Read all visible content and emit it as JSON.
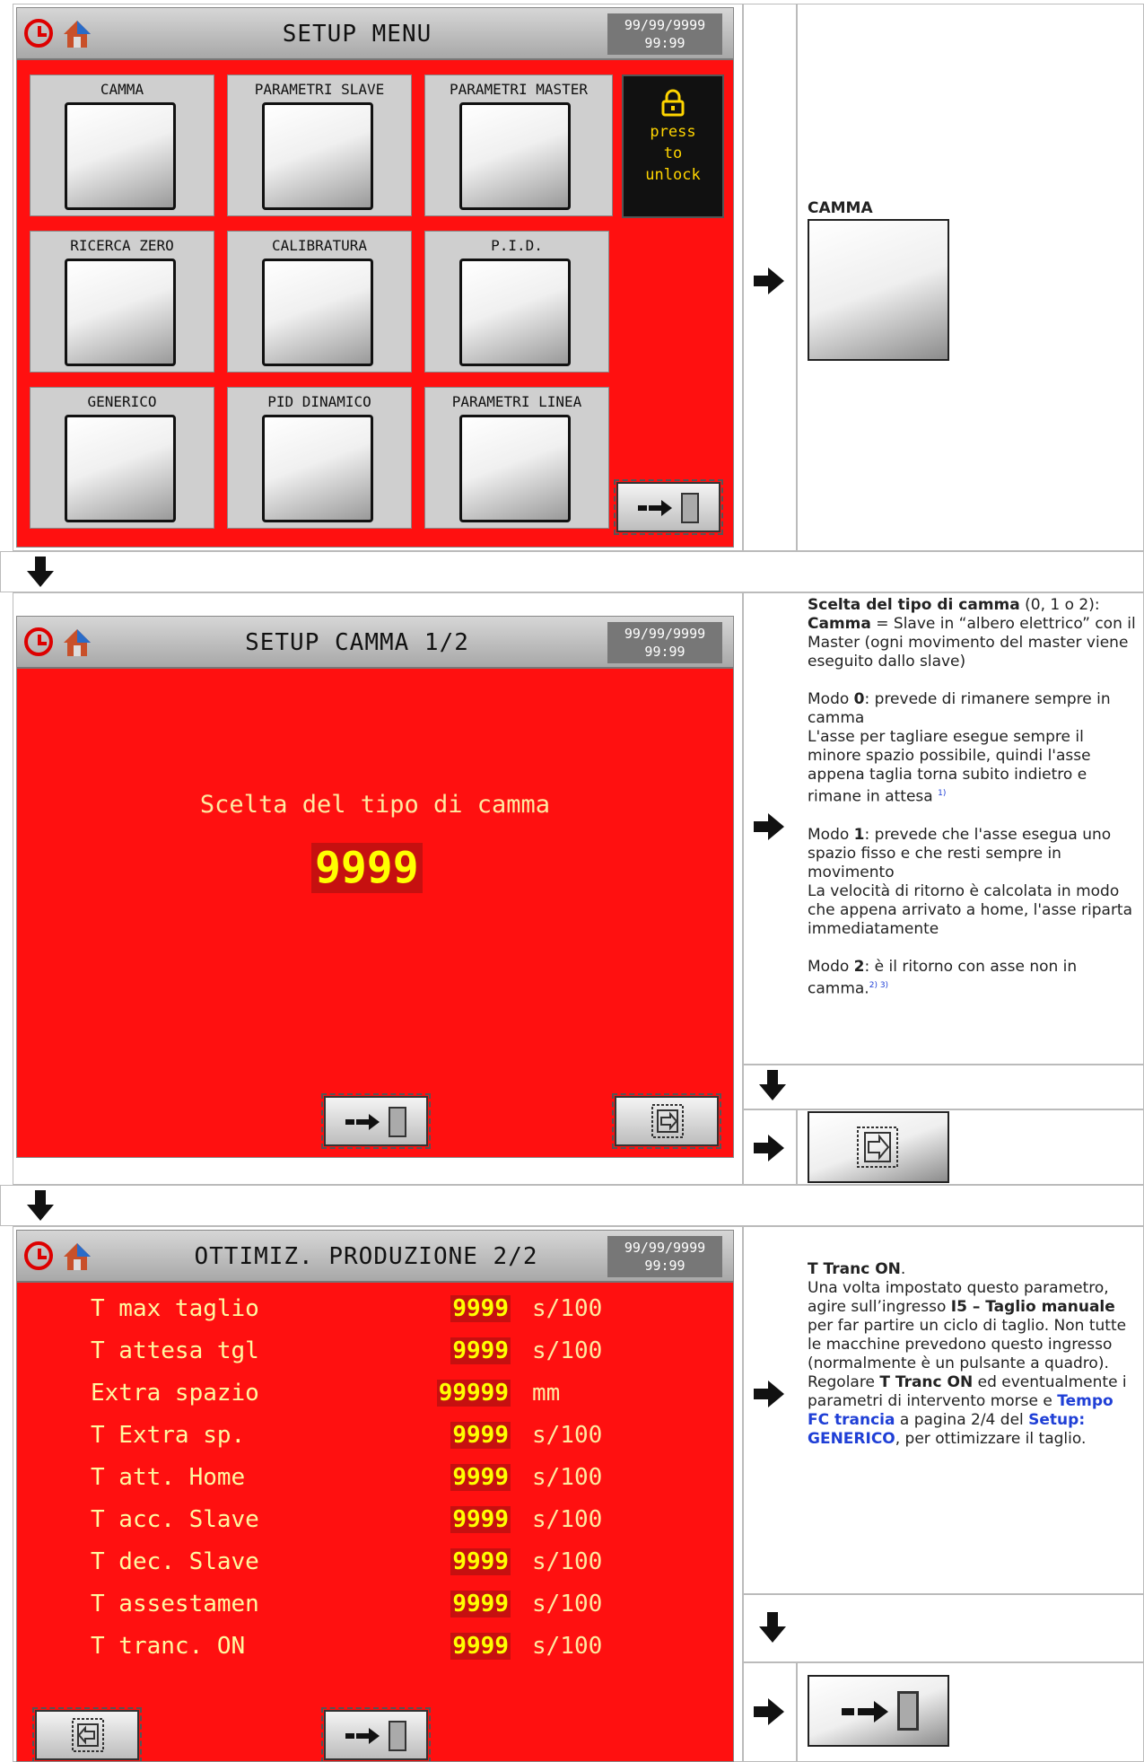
{
  "screen1": {
    "title": "SETUP MENU",
    "date": "99/99/9999",
    "time": "99:99",
    "tiles": [
      {
        "label": "CAMMA"
      },
      {
        "label": "PARAMETRI SLAVE"
      },
      {
        "label": "PARAMETRI MASTER"
      },
      {
        "label": "RICERCA ZERO"
      },
      {
        "label": "CALIBRATURA"
      },
      {
        "label": "P.I.D."
      },
      {
        "label": "GENERICO"
      },
      {
        "label": "PID DINAMICO"
      },
      {
        "label": "PARAMETRI LINEA"
      }
    ],
    "lock": {
      "line1": "press",
      "line2": "to",
      "line3": "unlock"
    }
  },
  "side1": {
    "heading": "CAMMA"
  },
  "screen2": {
    "title": "SETUP CAMMA 1/2",
    "date": "99/99/9999",
    "time": "99:99",
    "label": "Scelta del tipo di camma",
    "value": "9999"
  },
  "side2": {
    "p1_b": "Scelta del tipo di camma",
    "p1_t": " (0, 1 o 2):",
    "p2_b": "Camma",
    "p2_t": " = Slave in “albero elettrico” con il Master (ogni movimento del master viene eseguito dallo slave)",
    "p3_a": "Modo ",
    "p3_b": "0",
    "p3_t": ": prevede di rimanere sempre in camma",
    "p4": "L'asse per tagliare esegue sempre il minore spazio possibile, quindi l'asse appena taglia torna subito indietro e rimane in attesa",
    "p4_note": "1)",
    "p5_a": "Modo ",
    "p5_b": "1",
    "p5_t": ": prevede che l'asse esegua uno spazio fisso e che resti sempre in movimento",
    "p6": "La velocità di ritorno è calcolata in modo che appena arrivato a home, l'asse riparta immediatamente",
    "p7_a": "Modo ",
    "p7_b": "2",
    "p7_t": ": è il ritorno con asse non in camma.",
    "p7_note": "2) 3)"
  },
  "screen3": {
    "title": "OTTIMIZ. PRODUZIONE 2/2",
    "date": "99/99/9999",
    "time": "99:99",
    "rows": [
      {
        "label": "T max taglio",
        "value": "9999",
        "unit": "s/100"
      },
      {
        "label": "T attesa tgl",
        "value": "9999",
        "unit": "s/100"
      },
      {
        "label": "Extra spazio",
        "value": "99999",
        "unit": "mm"
      },
      {
        "label": "T Extra sp.",
        "value": "9999",
        "unit": "s/100"
      },
      {
        "label": "T att. Home",
        "value": "9999",
        "unit": "s/100"
      },
      {
        "label": "T acc. Slave",
        "value": "9999",
        "unit": "s/100"
      },
      {
        "label": "T dec. Slave",
        "value": "9999",
        "unit": "s/100"
      },
      {
        "label": "T assestamen",
        "value": "9999",
        "unit": "s/100"
      },
      {
        "label": "T tranc. ON",
        "value": "9999",
        "unit": "s/100"
      }
    ]
  },
  "side3": {
    "p1_b": "T Tranc ON",
    "p1_t": ".",
    "p2": "Una volta impostato questo parametro, agire sull’ingresso ",
    "p2_b": "I5 – Taglio manuale",
    "p3": "per far partire un ciclo di taglio. Non tutte le macchine prevedono questo ingresso (normalmente è un pulsante a quadro).",
    "p4_a": "Regolare ",
    "p4_b": "T Tranc ON",
    "p4_t": " ed eventualmente i parametri di intervento morse e ",
    "p4_link": "Tempo FC trancia",
    "p4_t2": " a pagina 2/4 del ",
    "p4_link2": "Setup: GENERICO",
    "p4_t3": ", per ottimizzare il taglio."
  }
}
